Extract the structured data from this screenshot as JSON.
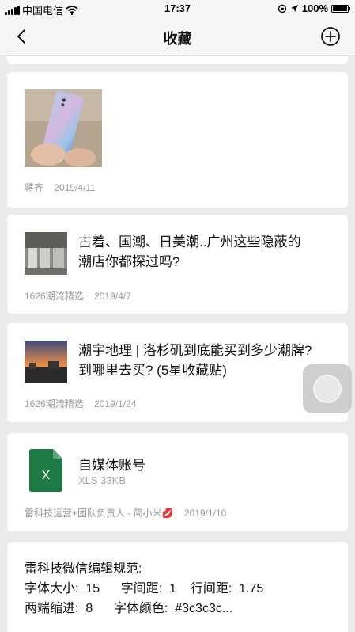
{
  "status_bar": {
    "carrier": "中国电信",
    "time": "17:37",
    "battery": "100%"
  },
  "nav": {
    "title": "收藏"
  },
  "items": [
    {
      "type": "image",
      "source": "蒋齐",
      "date": "2019/4/11"
    },
    {
      "type": "article",
      "title_line1": "古着、国潮、日美潮..广州这些隐蔽的",
      "title_line2": "潮店你都探过吗?",
      "source": "1626潮流精选",
      "date": "2019/4/7"
    },
    {
      "type": "article",
      "title_line1": "潮宇地理 | 洛杉矶到底能买到多少潮牌?",
      "title_line2": "到哪里去买? (5星收藏贴)",
      "source": "1626潮流精选",
      "date": "2019/1/24"
    },
    {
      "type": "file",
      "file_name": "自媒体账号",
      "file_meta": "XLS 33KB",
      "file_icon_letter": "X",
      "source": "雷科技运营+团队负责人 - 简小米💋",
      "date": "2019/1/10"
    },
    {
      "type": "note",
      "line1": "雷科技微信编辑规范:",
      "line2": "字体大小:  15      字间距:  1    行间距:  1.75",
      "line3": "两端缩进:  8      字体颜色:  #3c3c3c..."
    }
  ],
  "colors": {
    "xls_green": "#1e7a45",
    "background": "#ebebeb"
  }
}
